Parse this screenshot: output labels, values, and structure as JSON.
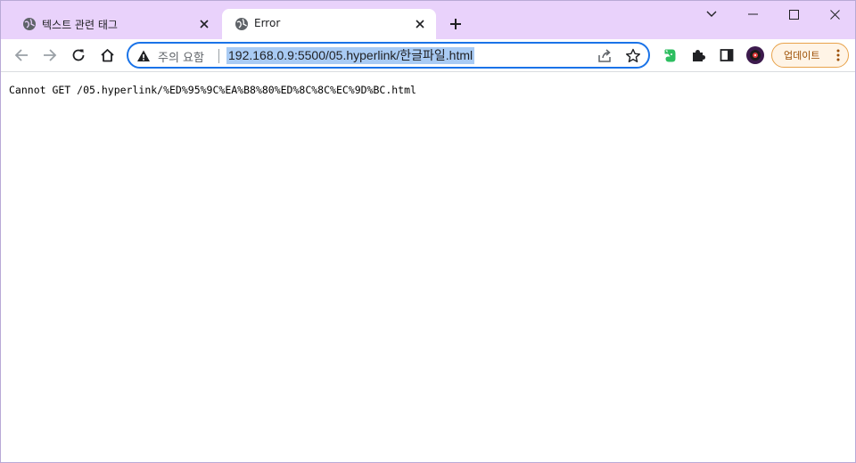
{
  "window": {
    "tabs": [
      {
        "title": "텍스트 관련 태그",
        "active": false,
        "favicon": "globe-icon"
      },
      {
        "title": "Error",
        "active": true,
        "favicon": "globe-icon"
      }
    ],
    "new_tab_icon": "plus-icon",
    "controls": [
      "chevron-down-icon",
      "minimize-icon",
      "maximize-icon",
      "close-icon"
    ]
  },
  "toolbar": {
    "back_icon": "arrow-left-icon",
    "forward_icon": "arrow-right-icon",
    "reload_icon": "reload-icon",
    "home_icon": "home-icon",
    "security_label": "주의 요함",
    "url": "192.168.0.9:5500/05.hyperlink/한글파일.html",
    "update_label": "업데이트"
  },
  "colors": {
    "tabstrip_bg": "#e9d2fb",
    "omnibox_focus": "#1a73e8",
    "url_selection": "#a9cbf4",
    "update_border": "#e8a24a",
    "update_bg": "#fff4e6"
  },
  "page": {
    "message": "Cannot GET /05.hyperlink/%ED%95%9C%EA%B8%80%ED%8C%8C%EC%9D%BC.html"
  }
}
